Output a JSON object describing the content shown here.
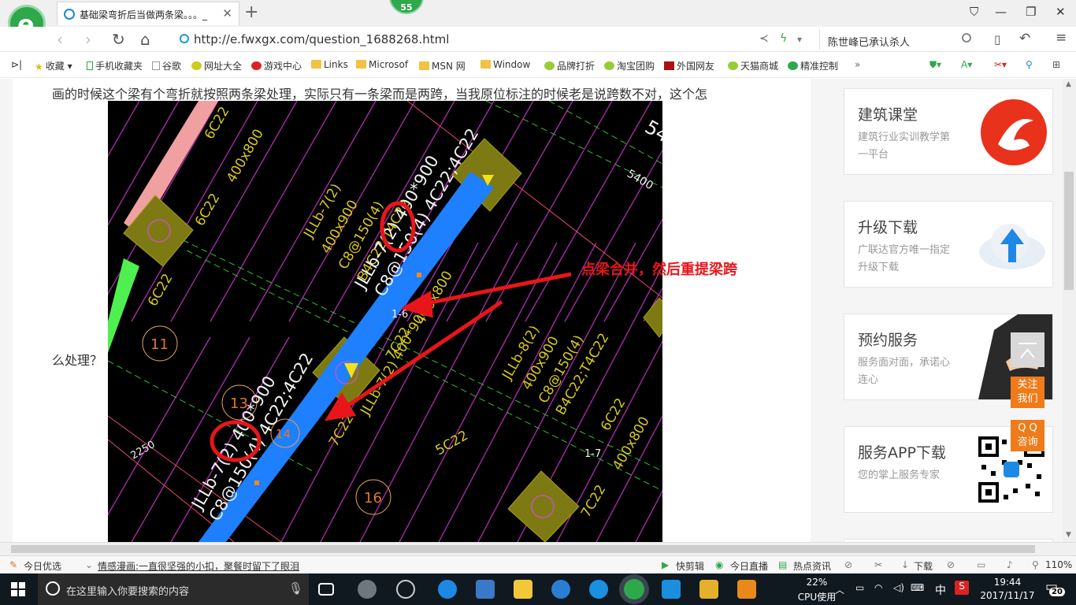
{
  "browser": {
    "tab_title": "基础梁弯折后当做两条梁。。。_",
    "close_tab": "✕",
    "new_tab": "+",
    "notification_count": "55",
    "url": "http://e.fwxgx.com/question_1688268.html",
    "search_text": "陈世峰已承认杀人"
  },
  "bookmarks": [
    {
      "label": "收藏"
    },
    {
      "label": "手机收藏夹"
    },
    {
      "label": "谷歌"
    },
    {
      "label": "网址大全"
    },
    {
      "label": "游戏中心"
    },
    {
      "label": "Links"
    },
    {
      "label": "Microsof"
    },
    {
      "label": "MSN 网"
    },
    {
      "label": "Window"
    },
    {
      "label": "品牌打折"
    },
    {
      "label": "淘宝团购"
    },
    {
      "label": "外国网友"
    },
    {
      "label": "天猫商城"
    },
    {
      "label": "精准控制"
    }
  ],
  "article": {
    "line1": "画的时候这个梁有个弯折就按照两条梁处理，实际只有一条梁而是两跨，当我原位标注的时候老是说跨数不对，这个怎",
    "line2": "么处理？",
    "annotation": "点梁合并，然后重提梁跨"
  },
  "cad": {
    "beam_upper": "JLLb-7(2) 400*900",
    "beam_upper_2": "C8@150(4) 4C22;4C22",
    "beam_upper_side": "JLLb-7(2)",
    "beam_upper_side_2": "400x900",
    "beam_upper_side_3": "C8@150(4)",
    "beam_upper_side_4": "B4C22;T4C22",
    "beam_right": "JLLb-8(2)",
    "beam_right_2": "400x900",
    "beam_right_3": "C8@150(4)",
    "beam_right_4": "B4C22;T4C22",
    "beam_lower": "JLLb-7(2) 400*900",
    "beam_lower_2": "C8@150(4) 4C22;4C22",
    "labels": [
      "6C22",
      "400x800",
      "6C22",
      "6C22",
      "7C22",
      "5C22",
      "7C22",
      "6C22",
      "400x800",
      "7C22",
      "400x800",
      "5400",
      "2250",
      "1-6",
      "1-7",
      "54"
    ],
    "circles": [
      "11",
      "13",
      "14",
      "16"
    ]
  },
  "sidebar": [
    {
      "title": "建筑课堂",
      "desc": "建筑行业实训教学第一平台"
    },
    {
      "title": "升级下载",
      "desc": "广联达官方唯一指定升级下载"
    },
    {
      "title": "预约服务",
      "desc": "服务面对面，承诺心连心"
    },
    {
      "title": "服务APP下载",
      "desc": "您的掌上服务专家"
    }
  ],
  "float": {
    "follow": "关注我们",
    "qq": "Q Q 咨询"
  },
  "statusbar": {
    "today": "今日优选",
    "news": "情感漫画:一直很坚强的小扣，聚餐时留下了眼泪",
    "cut": "快剪辑",
    "live": "今日直播",
    "hot": "热点资讯",
    "download": "下载",
    "zoom": "110%"
  },
  "taskbar": {
    "search_placeholder": "在这里输入你要搜索的内容",
    "cpu": "22%",
    "cpu_label": "CPU使用",
    "ime": "中",
    "time": "19:44",
    "date": "2017/11/17",
    "notif": "20"
  },
  "colors": {
    "cad_bg": "#000000",
    "beam_blue": "#1e7fff",
    "annotation_red": "#e8151b",
    "accent_orange": "#f07b1a"
  }
}
